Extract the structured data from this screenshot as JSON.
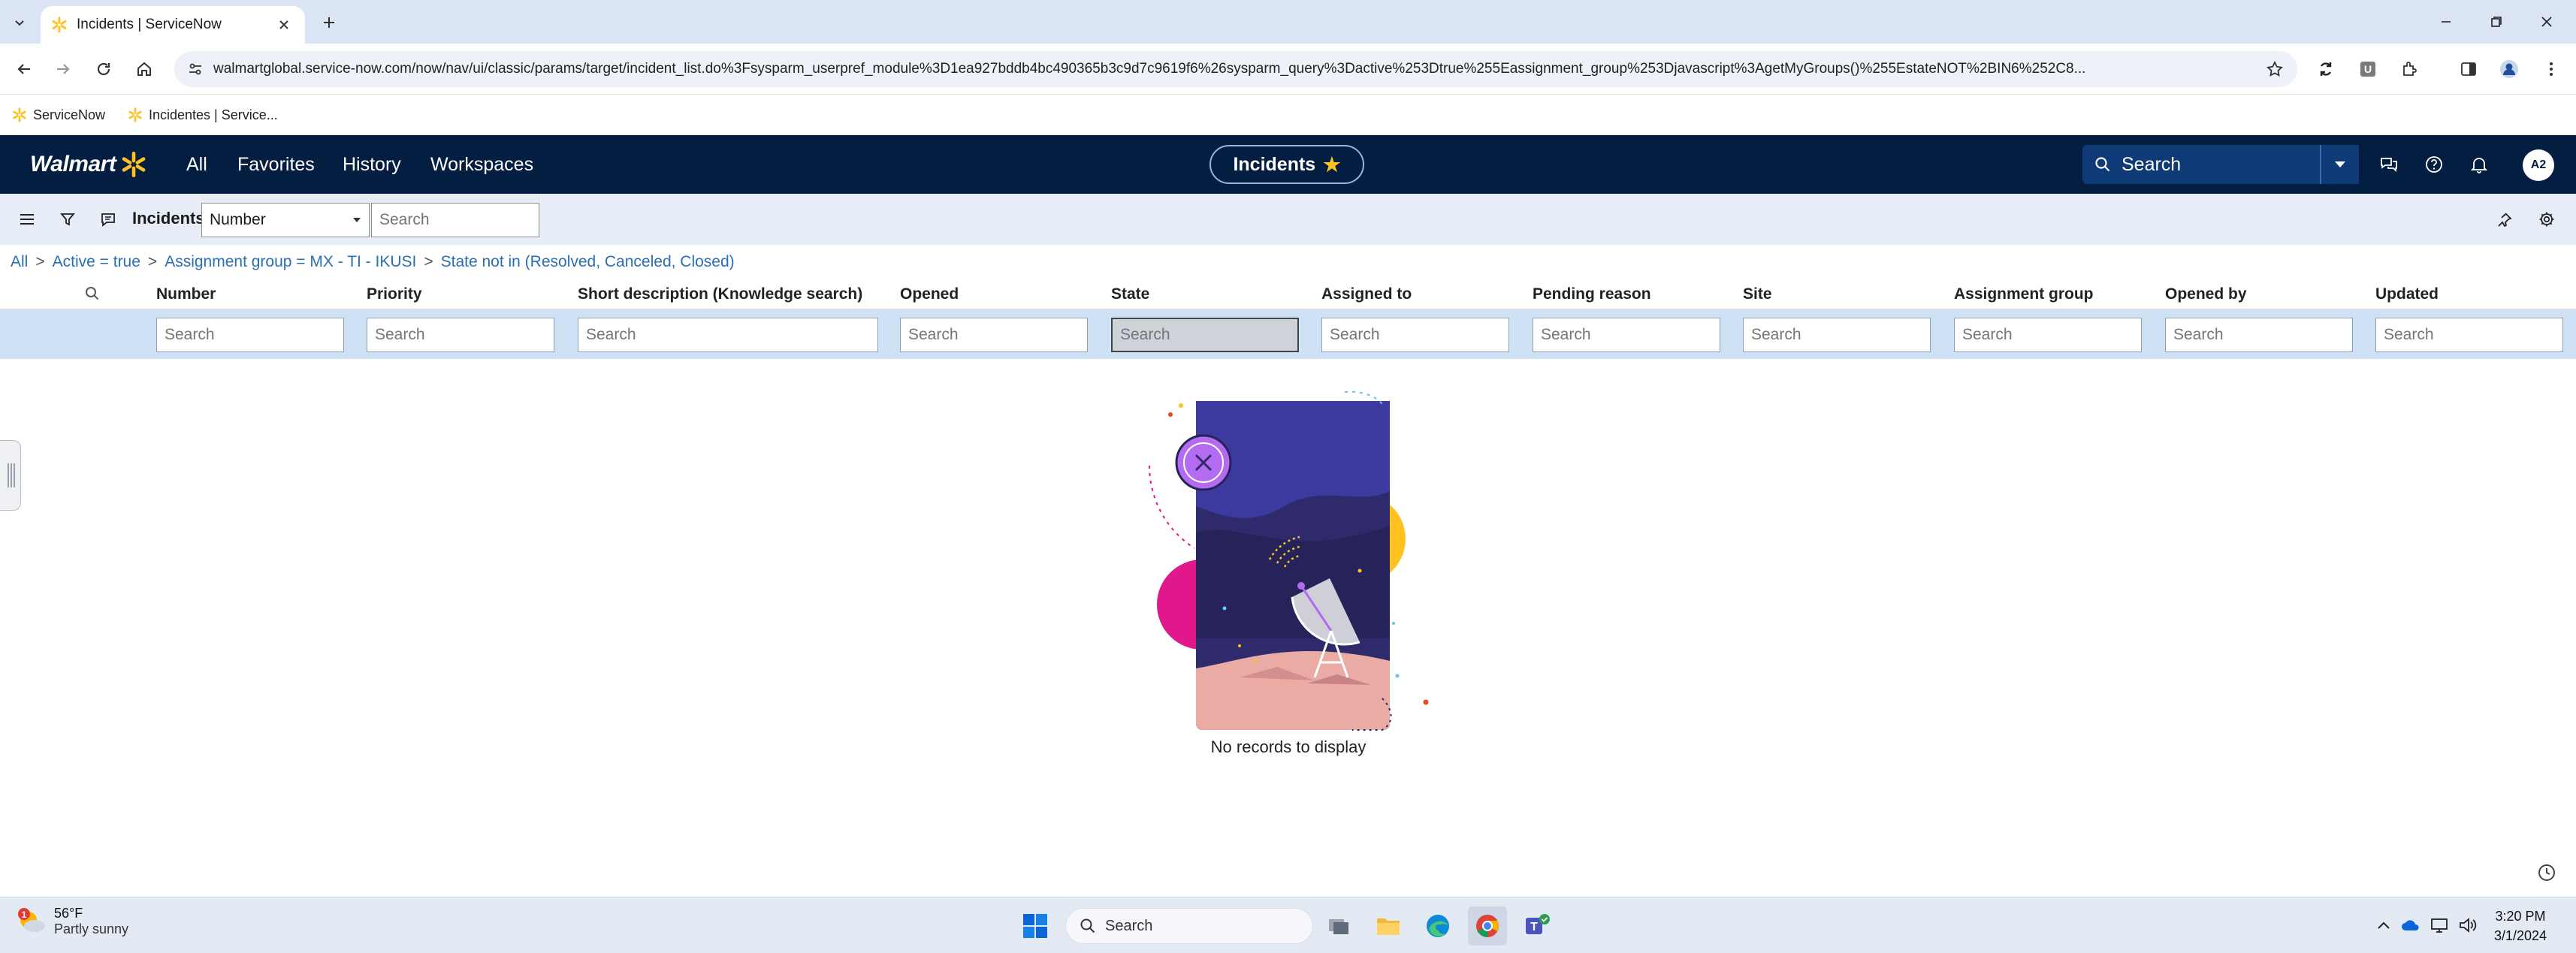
{
  "browser": {
    "tab_title": "Incidents | ServiceNow",
    "url": "walmartglobal.service-now.com/now/nav/ui/classic/params/target/incident_list.do%3Fsysparm_userpref_module%3D1ea927bddb4bc490365b3c9d7c9619f6%26sysparm_query%3Dactive%253Dtrue%255Eassignment_group%253Djavascript%3AgetMyGroups()%255EstateNOT%2BIN6%252C8...",
    "bookmarks": [
      "ServiceNow",
      "Incidentes | Service..."
    ]
  },
  "header": {
    "brand": "Walmart",
    "nav": [
      "All",
      "Favorites",
      "History",
      "Workspaces"
    ],
    "context_pill": "Incidents",
    "search_placeholder": "Search",
    "avatar_initials": "A2"
  },
  "list": {
    "title": "Incidents",
    "field_select": "Number",
    "search_placeholder": "Search"
  },
  "breadcrumb": [
    "All",
    "Active = true",
    "Assignment group = MX - TI - IKUSI",
    "State not in (Resolved, Canceled, Closed)"
  ],
  "columns": [
    "Number",
    "Priority",
    "Short description (Knowledge search)",
    "Opened",
    "State",
    "Assigned to",
    "Pending reason",
    "Site",
    "Assignment group",
    "Opened by",
    "Updated"
  ],
  "filter_placeholder": "Search",
  "empty_message": "No records to display",
  "taskbar": {
    "weather_temp": "56°F",
    "weather_desc": "Partly sunny",
    "search_label": "Search",
    "time": "3:20 PM",
    "date": "3/1/2024"
  },
  "colors": {
    "header_bg": "#041e42",
    "accent_yellow": "#ffc220",
    "link_blue": "#2a6fb5"
  }
}
